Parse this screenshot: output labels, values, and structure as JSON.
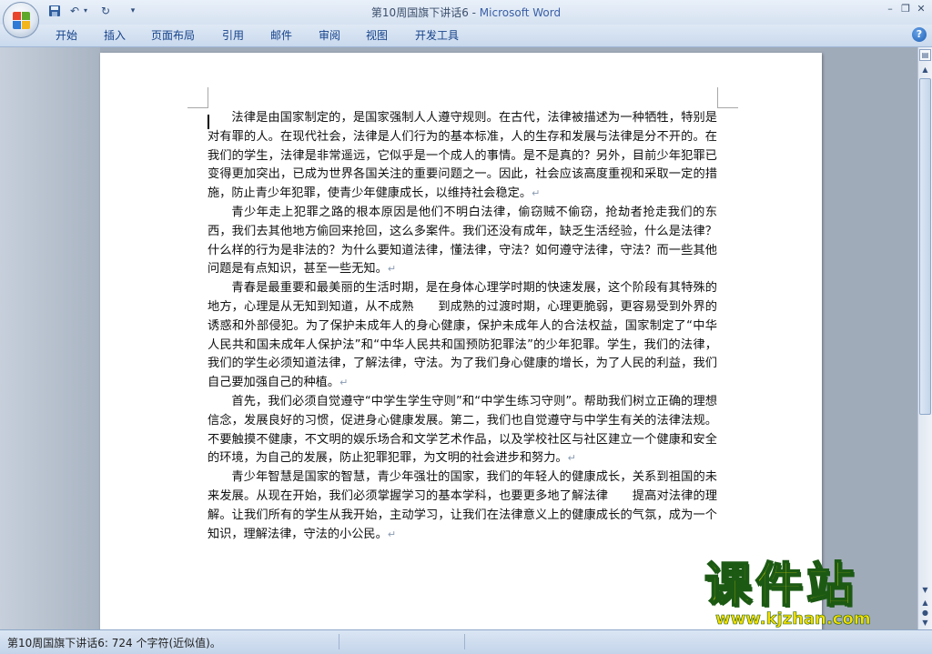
{
  "window": {
    "doc_name": "第10周国旗下讲话6",
    "separator": " - ",
    "app_name": "Microsoft Word"
  },
  "quick_access": {
    "save_icon": "save-icon",
    "undo_icon": "undo-icon",
    "redo_icon": "redo-icon",
    "customize_icon": "customize-qat-icon"
  },
  "window_controls": {
    "minimize": "–",
    "restore": "❐",
    "close": "✕"
  },
  "ribbon": {
    "tabs": [
      "开始",
      "插入",
      "页面布局",
      "引用",
      "邮件",
      "审阅",
      "视图",
      "开发工具"
    ],
    "help": "?"
  },
  "document": {
    "paragraphs": [
      "法律是由国家制定的，是国家强制人人遵守规则。在古代，法律被描述为一种牺牲，特别是对有罪的人。在现代社会，法律是人们行为的基本标准，人的生存和发展与法律是分不开的。在我们的学生，法律是非常遥远，它似乎是一个成人的事情。是不是真的？另外，目前少年犯罪已变得更加突出，已成为世界各国关注的重要问题之一。因此，社会应该高度重视和采取一定的措施，防止青少年犯罪，使青少年健康成长，以维持社会稳定。",
      "青少年走上犯罪之路的根本原因是他们不明白法律，偷窃贼不偷窃，抢劫者抢走我们的东西，我们去其他地方偷回来抢回，这么多案件。我们还没有成年，缺乏生活经验，什么是法律？什么样的行为是非法的？为什么要知道法律，懂法律，守法？如何遵守法律，守法？而一些其他问题是有点知识，甚至一些无知。",
      "青春是最重要和最美丽的生活时期，是在身体心理学时期的快速发展，这个阶段有其特殊的地方，心理是从无知到知道，从不成熟　　到成熟的过渡时期，心理更脆弱，更容易受到外界的诱惑和外部侵犯。为了保护未成年人的身心健康，保护未成年人的合法权益，国家制定了“中华人民共和国未成年人保护法”和“中华人民共和国预防犯罪法”的少年犯罪。学生，我们的法律，我们的学生必须知道法律，了解法律，守法。为了我们身心健康的增长，为了人民的利益，我们自己要加强自己的种植。",
      "首先，我们必须自觉遵守“中学生学生守则”和“中学生练习守则”。帮助我们树立正确的理想信念，发展良好的习惯，促进身心健康发展。第二，我们也自觉遵守与中学生有关的法律法规。不要触摸不健康，不文明的娱乐场合和文学艺术作品，以及学校社区与社区建立一个健康和安全的环境，为自己的发展，防止犯罪犯罪，为文明的社会进步和努力。",
      "青少年智慧是国家的智慧，青少年强壮的国家，我们的年轻人的健康成长，关系到祖国的未来发展。从现在开始，我们必须掌握学习的基本学科，也要更多地了解法律　　提高对法律的理解。让我们所有的学生从我开始，主动学习，让我们在法律意义上的健康成长的气氛，成为一个知识，理解法律，守法的小公民。"
    ],
    "paragraph_mark": "↵"
  },
  "watermark": {
    "title": "课件站",
    "url": "www.kjzhan.com"
  },
  "status": {
    "text": "第10周国旗下讲话6: 724 个字符(近似值)。"
  },
  "colors": {
    "title_brand": "#3a5fa6",
    "tab_text": "#15428b",
    "watermark_fill": "#f6e000",
    "watermark_stroke": "#1c5a14"
  }
}
